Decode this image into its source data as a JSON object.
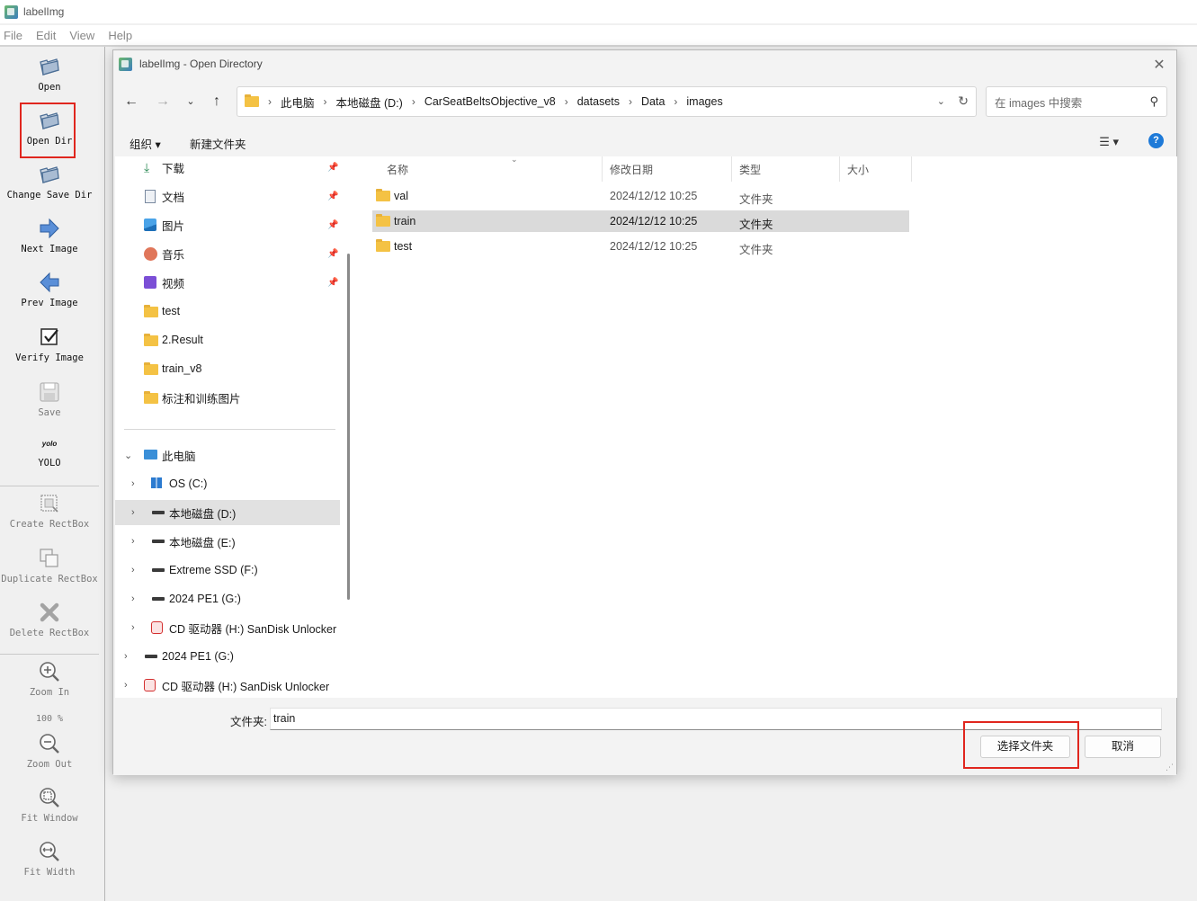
{
  "app": {
    "title": "labelImg",
    "menu": [
      "File",
      "Edit",
      "View",
      "Help"
    ],
    "zoom_level": "100 %",
    "tools": [
      {
        "label": "Open",
        "icon": "open-folder-icon",
        "enabled": true
      },
      {
        "label": "Open Dir",
        "icon": "open-dir-icon",
        "enabled": true
      },
      {
        "label": "Change Save Dir",
        "icon": "change-save-dir-icon",
        "enabled": true
      },
      {
        "label": "Next Image",
        "icon": "next-arrow-icon",
        "enabled": true
      },
      {
        "label": "Prev Image",
        "icon": "prev-arrow-icon",
        "enabled": true
      },
      {
        "label": "Verify Image",
        "icon": "verify-check-icon",
        "enabled": true
      },
      {
        "label": "Save",
        "icon": "save-icon",
        "enabled": false
      },
      {
        "label": "YOLO",
        "icon": "yolo-format-icon",
        "icon_text": "yolo",
        "enabled": true
      },
      {
        "label": "Create RectBox",
        "icon": "create-rectbox-icon",
        "enabled": false
      },
      {
        "label": "Duplicate RectBox",
        "icon": "duplicate-rectbox-icon",
        "enabled": false
      },
      {
        "label": "Delete RectBox",
        "icon": "delete-rectbox-icon",
        "enabled": false
      },
      {
        "label": "Zoom In",
        "icon": "zoom-in-icon",
        "enabled": false
      },
      {
        "label": "Zoom Out",
        "icon": "zoom-out-icon",
        "enabled": false
      },
      {
        "label": "Fit Window",
        "icon": "fit-window-icon",
        "enabled": false
      },
      {
        "label": "Fit Width",
        "icon": "fit-width-icon",
        "enabled": false
      }
    ]
  },
  "dialog": {
    "title": "labelImg - Open Directory",
    "breadcrumb": [
      "此电脑",
      "本地磁盘 (D:)",
      "CarSeatBeltsObjective_v8",
      "datasets",
      "Data",
      "images"
    ],
    "search_placeholder": "在 images 中搜索",
    "commands": {
      "organize": "组织 ▾",
      "new_folder": "新建文件夹"
    },
    "nav": {
      "quick_access": [
        {
          "label": "下载",
          "icon": "download-icon",
          "pinned": true
        },
        {
          "label": "文档",
          "icon": "document-icon",
          "pinned": true
        },
        {
          "label": "图片",
          "icon": "pictures-icon",
          "pinned": true
        },
        {
          "label": "音乐",
          "icon": "music-icon",
          "pinned": true
        },
        {
          "label": "视频",
          "icon": "video-icon",
          "pinned": true
        },
        {
          "label": "test",
          "icon": "folder-icon",
          "pinned": false
        },
        {
          "label": "2.Result",
          "icon": "folder-icon",
          "pinned": false
        },
        {
          "label": "train_v8",
          "icon": "folder-icon",
          "pinned": false
        },
        {
          "label": "标注和训练图片",
          "icon": "folder-icon",
          "pinned": false
        }
      ],
      "this_pc": "此电脑",
      "drives": [
        {
          "label": "OS (C:)",
          "icon": "windows-drive-icon",
          "selected": false
        },
        {
          "label": "本地磁盘 (D:)",
          "icon": "drive-icon",
          "selected": true
        },
        {
          "label": "本地磁盘 (E:)",
          "icon": "drive-icon",
          "selected": false
        },
        {
          "label": "Extreme SSD (F:)",
          "icon": "drive-icon",
          "selected": false
        },
        {
          "label": "2024 PE1 (G:)",
          "icon": "drive-icon",
          "selected": false
        },
        {
          "label": "CD 驱动器 (H:) SanDisk Unlocker",
          "icon": "cd-drive-icon",
          "selected": false
        }
      ],
      "root_items": [
        {
          "label": "2024 PE1 (G:)",
          "icon": "drive-icon"
        },
        {
          "label": "CD 驱动器 (H:) SanDisk Unlocker",
          "icon": "cd-drive-icon"
        }
      ]
    },
    "columns": [
      "名称",
      "修改日期",
      "类型",
      "大小"
    ],
    "files": [
      {
        "name": "val",
        "modified": "2024/12/12 10:25",
        "type": "文件夹",
        "size": "",
        "selected": false
      },
      {
        "name": "train",
        "modified": "2024/12/12 10:25",
        "type": "文件夹",
        "size": "",
        "selected": true
      },
      {
        "name": "test",
        "modified": "2024/12/12 10:25",
        "type": "文件夹",
        "size": "",
        "selected": false
      }
    ],
    "folder_label": "文件夹:",
    "folder_value": "train",
    "select_button": "选择文件夹",
    "cancel_button": "取消"
  },
  "colors": {
    "highlight": "#e0261e",
    "selection": "#dadada",
    "folder": "#f4c244",
    "help": "#1e7ad8"
  }
}
